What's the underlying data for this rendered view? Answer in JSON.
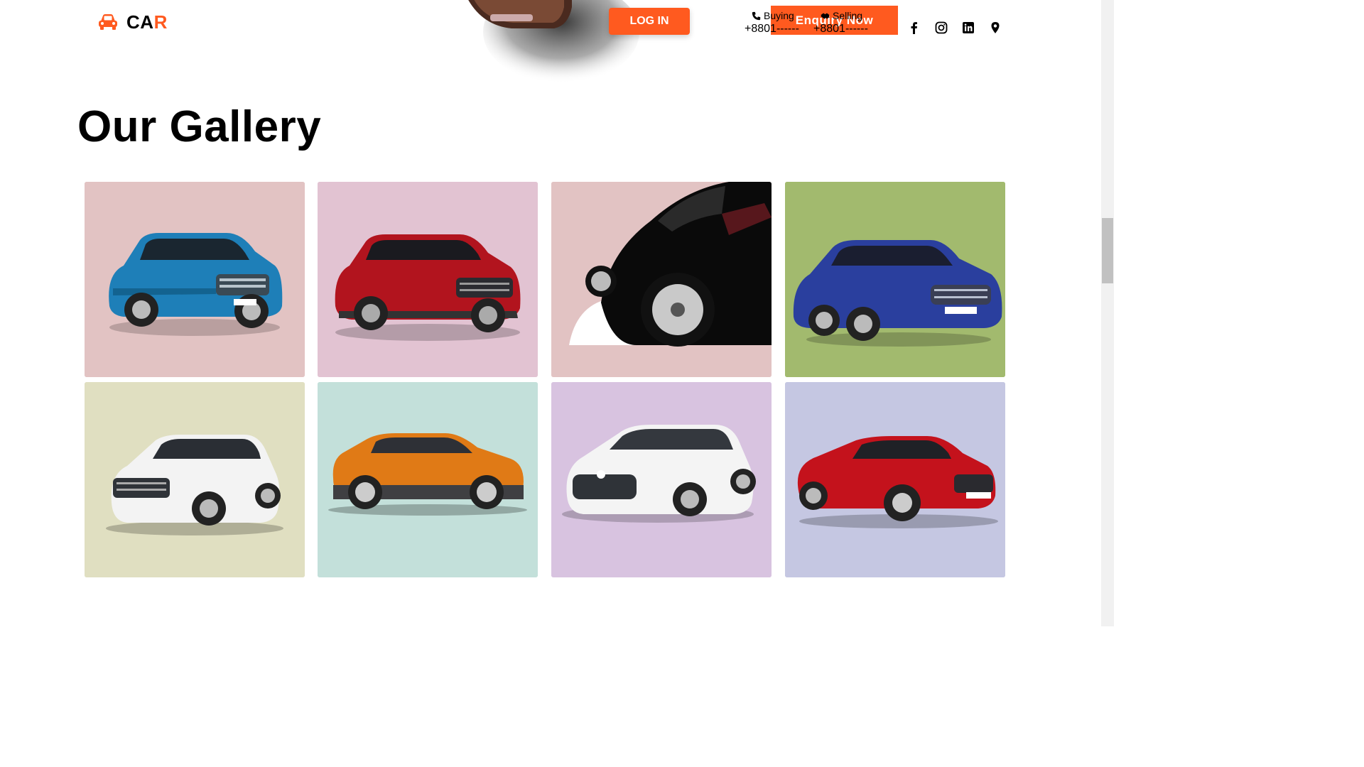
{
  "header": {
    "logo": {
      "text_main": "CA",
      "text_accent": "R",
      "icon": "car-icon"
    },
    "login_label": "LOG IN",
    "enquiry_label": "Enquiry Now",
    "contacts": [
      {
        "label": "Buying",
        "number": "+8801------",
        "icon": "phone-icon"
      },
      {
        "label": "Selling",
        "number": "+8801------",
        "icon": "handshake-icon"
      }
    ],
    "socials": [
      "facebook-icon",
      "instagram-icon",
      "linkedin-icon",
      "location-pin-icon"
    ]
  },
  "gallery": {
    "title": "Our Gallery",
    "tiles": [
      {
        "bg": "#e2c3c3",
        "car": "blue-suv"
      },
      {
        "bg": "#e2c3d2",
        "car": "red-suv"
      },
      {
        "bg": "#e2c3c3",
        "car": "black-car-closeup"
      },
      {
        "bg": "#a2ba6e",
        "car": "blue-sedan"
      },
      {
        "bg": "#e0dfc1",
        "car": "white-suv"
      },
      {
        "bg": "#c3e0da",
        "car": "orange-crossover"
      },
      {
        "bg": "#d8c3e0",
        "car": "white-sedan"
      },
      {
        "bg": "#c5c7e2",
        "car": "red-coupe"
      }
    ]
  },
  "colors": {
    "accent": "#ff5a1f"
  }
}
